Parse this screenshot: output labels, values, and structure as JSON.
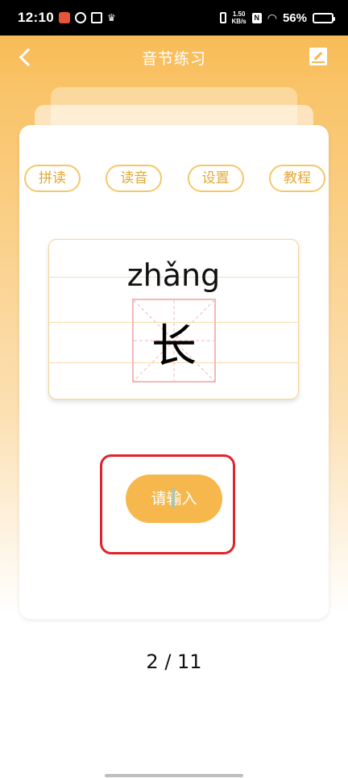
{
  "status_bar": {
    "time": "12:10",
    "network_speed_top": "1.50",
    "network_speed_bottom": "KB/s",
    "nfc_label": "N",
    "battery_text": "56%"
  },
  "nav": {
    "title": "音节练习"
  },
  "tabs": [
    {
      "label": "拼读"
    },
    {
      "label": "读音"
    },
    {
      "label": "设置"
    },
    {
      "label": "教程"
    }
  ],
  "practice": {
    "pinyin": "zhǎng",
    "hanzi": "长"
  },
  "input_button": {
    "label": "请输入"
  },
  "progress": {
    "text": "2 / 11"
  },
  "colors": {
    "accent": "#F6B84C",
    "tab_border": "#F3C86B",
    "highlight": "#E0242A"
  }
}
